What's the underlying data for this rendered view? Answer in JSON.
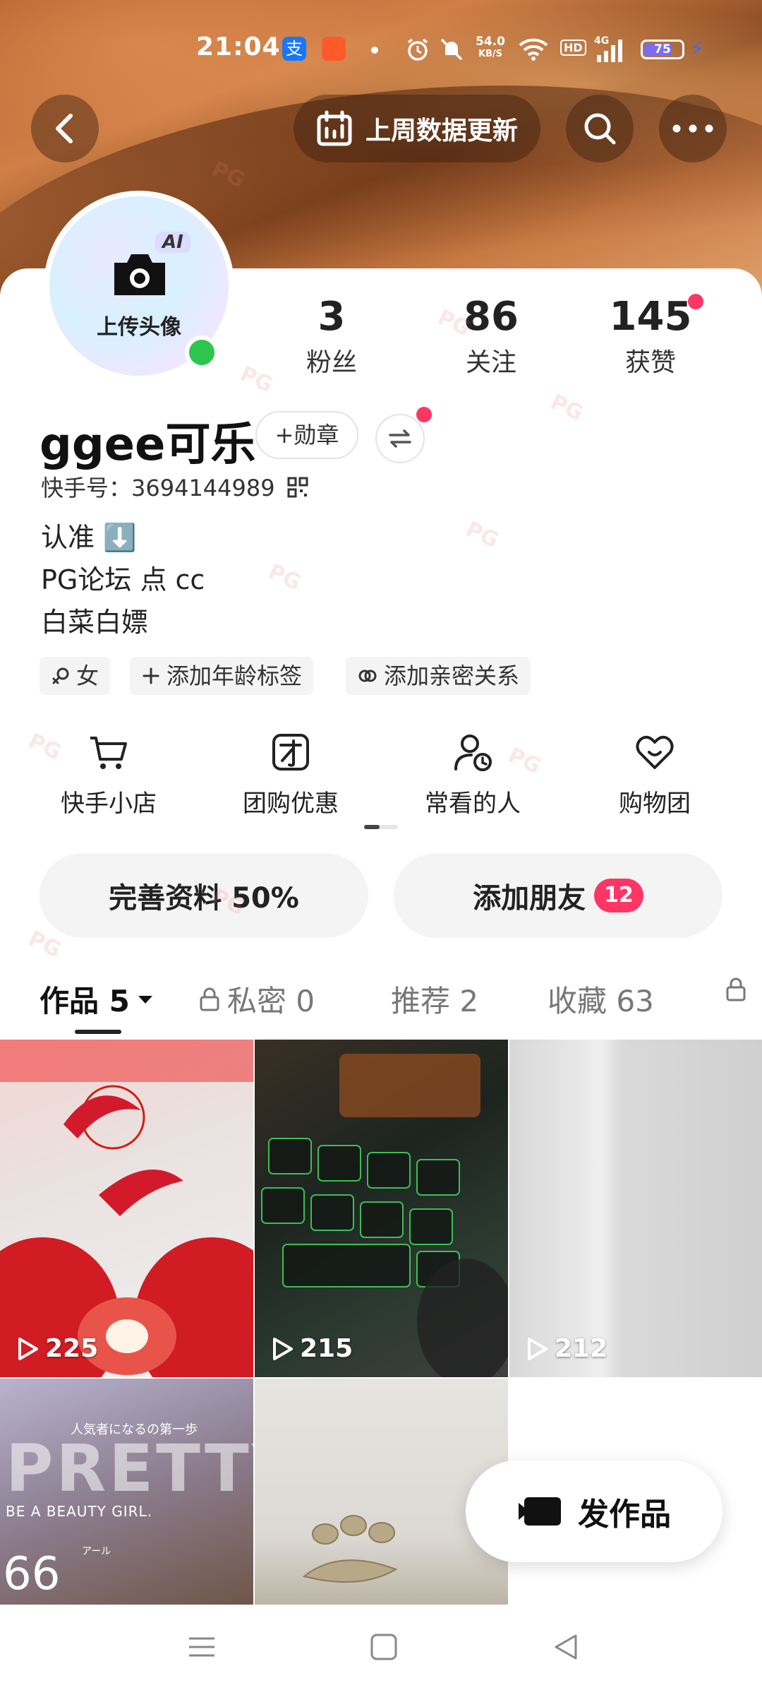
{
  "status_bar": {
    "time": "21:04",
    "app_icon_1": "支",
    "net_speed_value": "54.0",
    "net_speed_unit": "KB/S",
    "hd_label": "HD",
    "network_type": "4G",
    "battery": "75",
    "battery_level": 0.75,
    "icons": [
      "alipay-icon",
      "app-icon",
      "alarm-icon",
      "mute-icon",
      "wifi-icon",
      "signal-icon",
      "battery-icon",
      "charging-icon"
    ]
  },
  "header": {
    "back_icon": "chevron-left-icon",
    "weekly_update": "上周数据更新",
    "search_icon": "search-icon",
    "more_icon": "more-icon"
  },
  "profile": {
    "avatar_ai": "AI",
    "avatar_label": "上传头像",
    "stats": [
      {
        "value": "3",
        "label": "粉丝"
      },
      {
        "value": "86",
        "label": "关注"
      },
      {
        "value": "145",
        "label": "获赞"
      }
    ],
    "username": "ggee可乐",
    "badge_button": "+勋章",
    "kuaishou_id": "快手号：3694144989",
    "bio_lines": [
      "认准 ⬇️",
      "PG论坛 点 cc",
      "白菜白嫖"
    ],
    "tags": [
      "女",
      "添加年龄标签",
      "添加亲密关系"
    ]
  },
  "features": [
    {
      "label": "快手小店",
      "icon": "cart-icon"
    },
    {
      "label": "团购优惠",
      "icon": "group-buy-icon"
    },
    {
      "label": "常看的人",
      "icon": "frequent-people-icon"
    },
    {
      "label": "购物团",
      "icon": "shopping-group-icon"
    }
  ],
  "actions": {
    "complete_profile": "完善资料 50%",
    "add_friends": "添加朋友",
    "add_friends_count": "12"
  },
  "tabs": [
    {
      "label": "作品 5",
      "active": true
    },
    {
      "label": "私密 0",
      "locked": true
    },
    {
      "label": "推荐 2"
    },
    {
      "label": "收藏 63"
    },
    {
      "label": "",
      "locked": true
    }
  ],
  "works": [
    {
      "plays": "225"
    },
    {
      "plays": "215"
    },
    {
      "plays": "212"
    },
    {
      "plays": "",
      "overlay_text_1": "人気者になるの第一歩",
      "overlay_text_2": "PRETTY",
      "overlay_text_3": "BE A BEAUTY GIRL.",
      "overlay_text_4": "66",
      "overlay_text_5": "アール"
    },
    {
      "plays": ""
    }
  ],
  "post_button": "发作品",
  "watermark": "PG",
  "system_nav": {
    "icons": [
      "menu-icon",
      "home-icon",
      "back-triangle-icon"
    ]
  }
}
